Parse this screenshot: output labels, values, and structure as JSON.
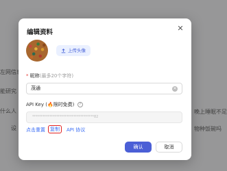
{
  "background": {
    "left_texts": [
      "左网信息",
      "能研究",
      "什么人",
      "设"
    ],
    "right_texts": [
      "晚上睡眠不足的孩",
      "物种饭碗吗"
    ]
  },
  "modal": {
    "title": "编辑资料",
    "upload_avatar_label": "上传头像",
    "nickname_label": "昵称",
    "nickname_hint": "(最多20个字符)",
    "nickname_value": "茂通",
    "apikey_label": "API Key",
    "apikey_note": "(🔥限时免费)",
    "apikey_value": "************************************82",
    "reset_link": "点击重置",
    "copy_link": "复制",
    "api_doc_link": "API 协议",
    "confirm_label": "确认",
    "cancel_label": "取消"
  },
  "colors": {
    "accent": "#4b5fd6",
    "link": "#3b6ef5",
    "required": "#e53935",
    "highlight_border": "#e02020"
  },
  "icons": [
    "close-icon",
    "upload-icon",
    "clear-icon",
    "info-icon"
  ]
}
